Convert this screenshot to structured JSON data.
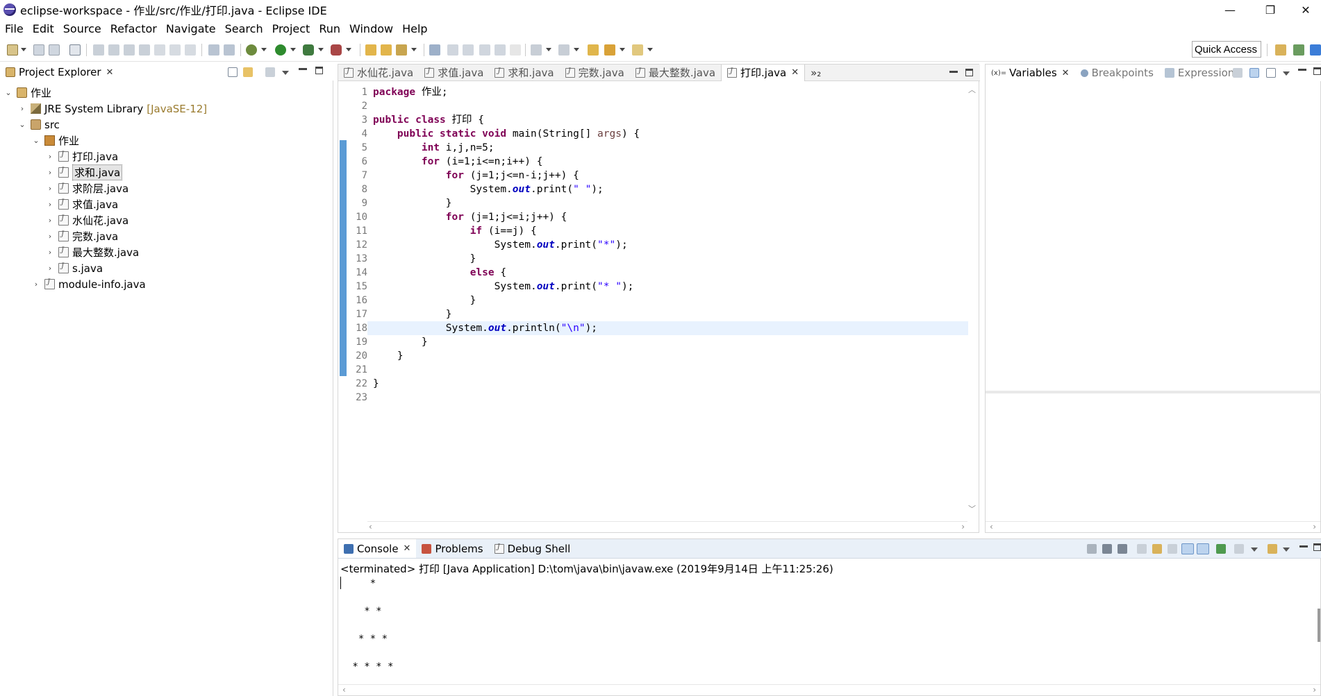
{
  "window": {
    "title": "eclipse-workspace - 作业/src/作业/打印.java - Eclipse IDE"
  },
  "menubar": {
    "items": [
      "File",
      "Edit",
      "Source",
      "Refactor",
      "Navigate",
      "Search",
      "Project",
      "Run",
      "Window",
      "Help"
    ]
  },
  "toolbar": {
    "quick_access": "Quick Access"
  },
  "explorer": {
    "tab_label": "Project Explorer",
    "project": "作业",
    "jre": "JRE System Library",
    "jre_version": "[JavaSE-12]",
    "src": "src",
    "package": "作业",
    "files": [
      "打印.java",
      "求和.java",
      "求阶层.java",
      "求值.java",
      "水仙花.java",
      "完数.java",
      "最大整数.java",
      "s.java"
    ],
    "module_info": "module-info.java"
  },
  "editor": {
    "tabs": [
      "水仙花.java",
      "求值.java",
      "求和.java",
      "完数.java",
      "最大整数.java",
      "打印.java"
    ],
    "active_tab": "打印.java",
    "overflow": "»₂",
    "line_numbers": [
      "1",
      "2",
      "3",
      "4",
      "5",
      "6",
      "7",
      "8",
      "9",
      "10",
      "11",
      "12",
      "13",
      "14",
      "15",
      "16",
      "17",
      "18",
      "19",
      "20",
      "21",
      "22",
      "23"
    ],
    "current_line": 18
  },
  "debug_views": {
    "variables": "Variables",
    "breakpoints": "Breakpoints",
    "expressions": "Expressions"
  },
  "console": {
    "tabs": [
      "Console",
      "Problems",
      "Debug Shell"
    ],
    "header": "<terminated> 打印 [Java Application] D:\\tom\\java\\bin\\javaw.exe (2019年9月14日 上午11:25:26)",
    "output": [
      "    *",
      "   * *",
      "  * * *",
      " * * * *"
    ]
  },
  "colors": {
    "keyword": "#7f0055",
    "string": "#2a00ff",
    "field": "#0000c0",
    "console_tabbar": "#e9f0f8"
  }
}
